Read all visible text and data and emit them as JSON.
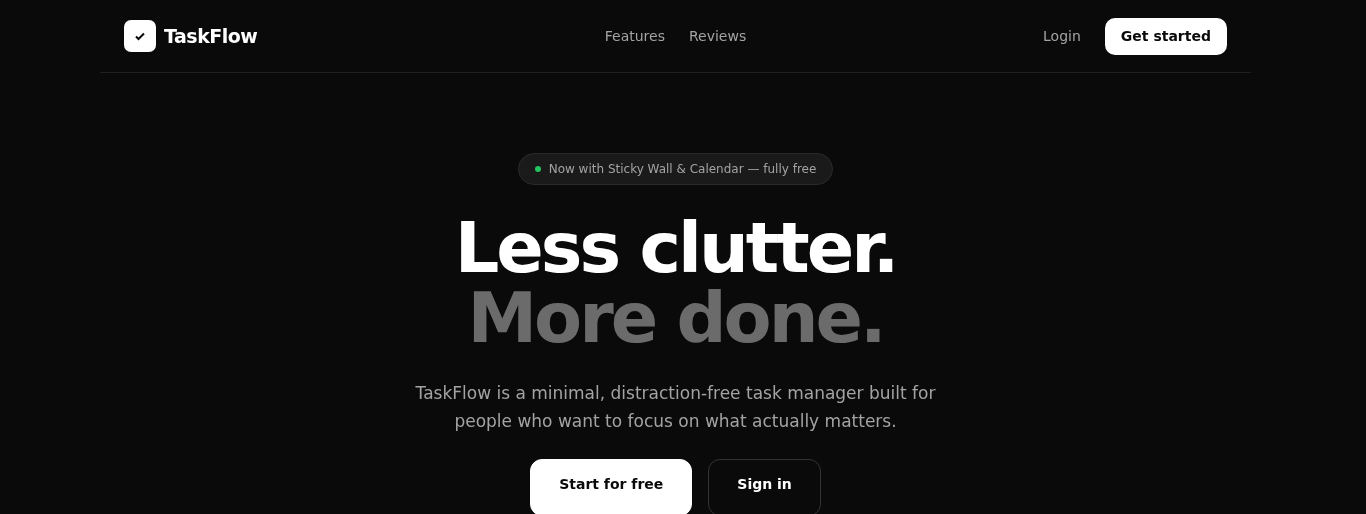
{
  "brand": {
    "name": "TaskFlow"
  },
  "nav_links": [
    "Features",
    "Reviews"
  ],
  "nav_actions": {
    "login": "Login",
    "cta": "Get started"
  },
  "announcement": {
    "text": "Now with Sticky Wall & Calendar — fully free",
    "color": "#22c55e"
  },
  "hero": {
    "headline": "Less clutter.",
    "subheadline": "More done.",
    "description": "TaskFlow is a minimal, distraction-free task manager built for people who want to focus on what actually matters."
  },
  "buttons": [
    {
      "label": "Start for free",
      "kind": "primary"
    },
    {
      "label": "Sign in",
      "kind": "outline"
    }
  ]
}
